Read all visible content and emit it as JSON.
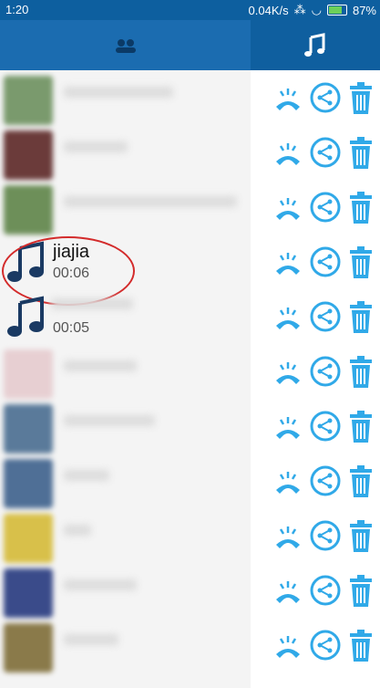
{
  "status": {
    "time": "1:20",
    "speed": "0.04K/s",
    "battery": "87%"
  },
  "tabs": {
    "left_icon": "contacts-icon",
    "right_icon": "music-note-icon"
  },
  "items": [
    {
      "type": "blurred"
    },
    {
      "type": "blurred"
    },
    {
      "type": "blurred"
    },
    {
      "type": "music",
      "name": "jiajia",
      "duration": "00:06"
    },
    {
      "type": "music",
      "name": "",
      "duration": "00:05"
    },
    {
      "type": "blurred"
    },
    {
      "type": "blurred"
    },
    {
      "type": "blurred"
    },
    {
      "type": "blurred"
    },
    {
      "type": "blurred"
    },
    {
      "type": "blurred"
    }
  ],
  "colors": {
    "accent": "#30a9e8",
    "header": "#1b6cb0",
    "highlight": "#d32b2b"
  }
}
